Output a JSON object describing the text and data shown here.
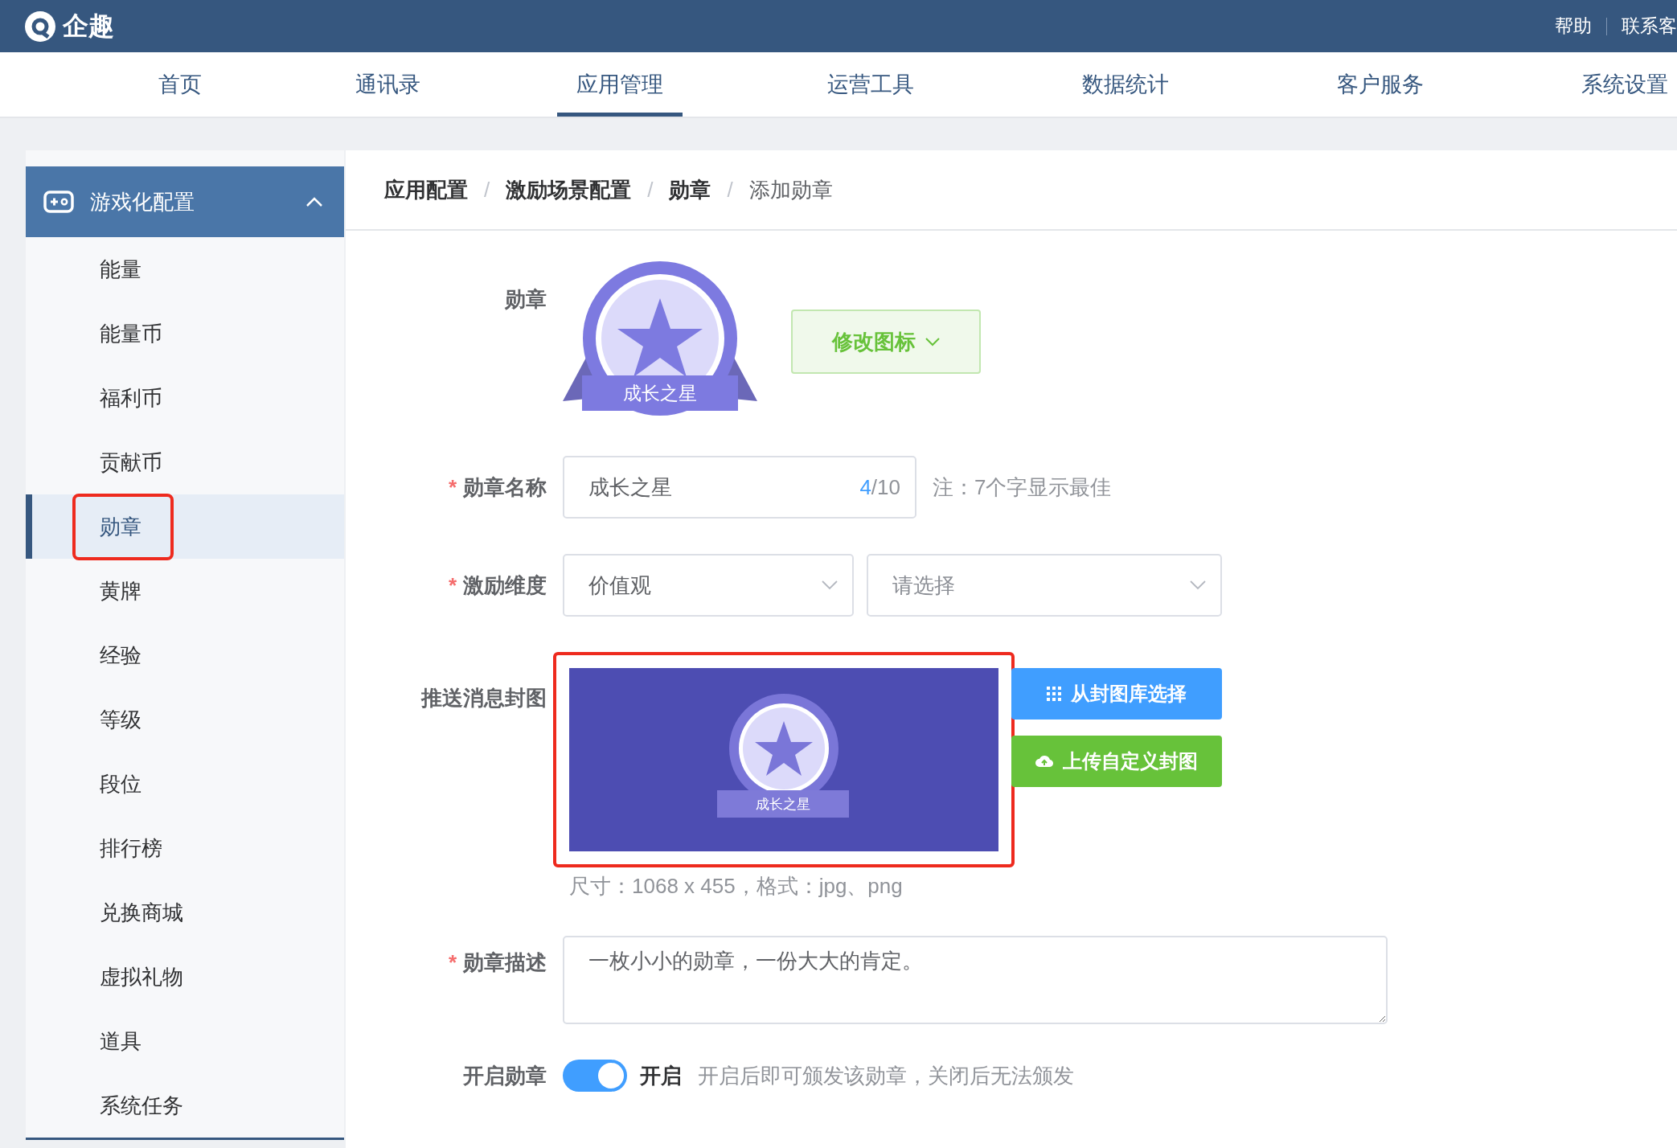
{
  "header": {
    "logo": "企趣",
    "links": [
      "帮助",
      "联系客"
    ]
  },
  "nav": [
    {
      "label": "首页",
      "selected": false
    },
    {
      "label": "通讯录",
      "selected": false
    },
    {
      "label": "应用管理",
      "selected": true
    },
    {
      "label": "运营工具",
      "selected": false
    },
    {
      "label": "数据统计",
      "selected": false
    },
    {
      "label": "客户服务",
      "selected": false
    },
    {
      "label": "系统设置",
      "selected": false
    }
  ],
  "sidebar": {
    "title": "游戏化配置",
    "expanded": true,
    "items": [
      {
        "label": "能量",
        "selected": false,
        "highlighted": false
      },
      {
        "label": "能量币",
        "selected": false,
        "highlighted": false
      },
      {
        "label": "福利币",
        "selected": false,
        "highlighted": false
      },
      {
        "label": "贡献币",
        "selected": false,
        "highlighted": false
      },
      {
        "label": "勋章",
        "selected": true,
        "highlighted": true
      },
      {
        "label": "黄牌",
        "selected": false,
        "highlighted": false
      },
      {
        "label": "经验",
        "selected": false,
        "highlighted": false
      },
      {
        "label": "等级",
        "selected": false,
        "highlighted": false
      },
      {
        "label": "段位",
        "selected": false,
        "highlighted": false
      },
      {
        "label": "排行榜",
        "selected": false,
        "highlighted": false
      },
      {
        "label": "兑换商城",
        "selected": false,
        "highlighted": false
      },
      {
        "label": "虚拟礼物",
        "selected": false,
        "highlighted": false
      },
      {
        "label": "道具",
        "selected": false,
        "highlighted": false
      },
      {
        "label": "系统任务",
        "selected": false,
        "highlighted": false
      }
    ]
  },
  "breadcrumb": [
    {
      "label": "应用配置",
      "current": false
    },
    {
      "label": "激励场景配置",
      "current": false
    },
    {
      "label": "勋章",
      "current": false
    },
    {
      "label": "添加勋章",
      "current": true
    }
  ],
  "breadcrumb_separator": "/",
  "form": {
    "badge": {
      "label": "勋章",
      "badge_text": "成长之星",
      "button": "修改图标"
    },
    "name": {
      "label": "勋章名称",
      "required_mark": "*",
      "value": "成长之星",
      "count": "4",
      "limit": "/10",
      "note": "注：7个字显示最佳"
    },
    "dimension": {
      "label": "激励维度",
      "required_mark": "*",
      "selects": [
        {
          "value": "价值观",
          "placeholder": false
        },
        {
          "value": "请选择",
          "placeholder": true
        }
      ]
    },
    "cover": {
      "label": "推送消息封图",
      "badge_text": "成长之星",
      "highlighted": true,
      "buttons": [
        {
          "label": "从封图库选择",
          "kind": "library"
        },
        {
          "label": "上传自定义封图",
          "kind": "upload"
        }
      ],
      "hint": "尺寸：1068 x 455，格式：jpg、png"
    },
    "description": {
      "label": "勋章描述",
      "required_mark": "*",
      "value": "一枚小小的勋章，一份大大的肯定。"
    },
    "enable": {
      "label": "开启勋章",
      "on": true,
      "state_text": "开启",
      "hint": "开启后即可颁发该勋章，关闭后无法颁发"
    }
  }
}
